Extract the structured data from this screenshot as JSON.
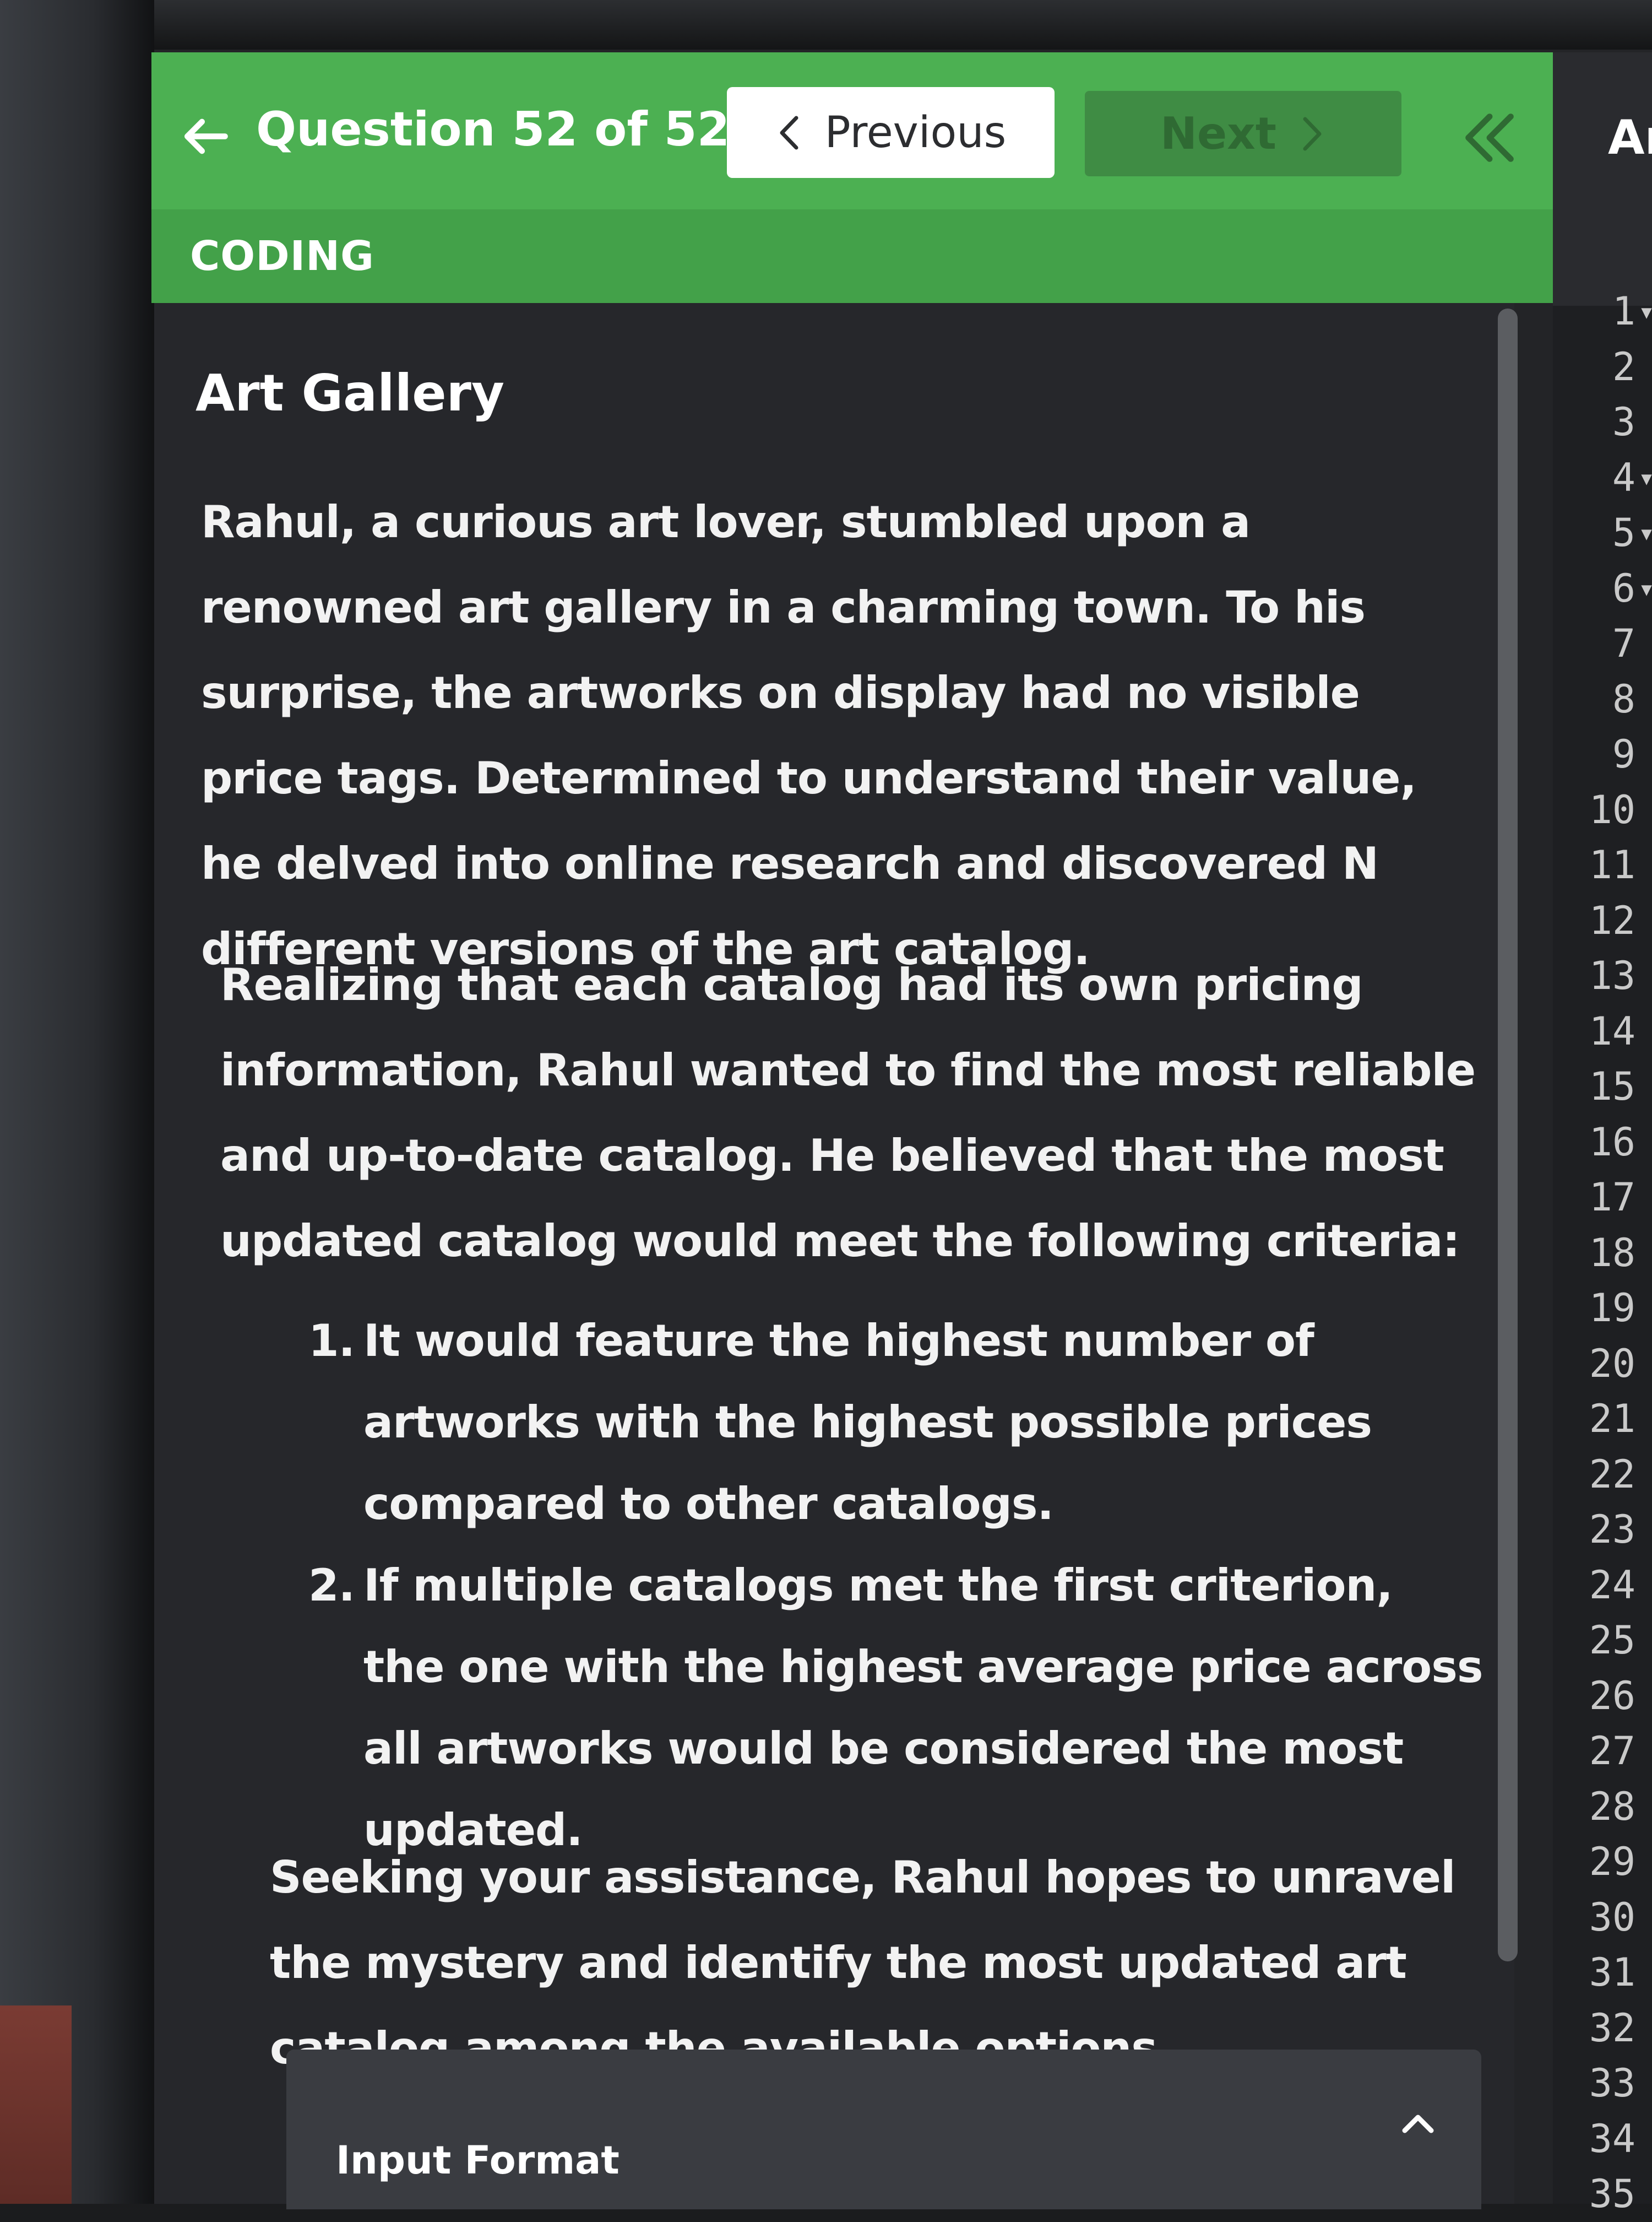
{
  "header": {
    "question_title": "Question 52 of 52",
    "previous_label": "Previous",
    "next_label": "Next",
    "category": "CODING",
    "accent_color": "#4cb052"
  },
  "problem": {
    "title": "Art Gallery",
    "paragraph1": "Rahul, a curious art lover, stumbled upon a renowned art gallery in a charming town. To his surprise, the artworks on display had no visible price tags. Determined to understand their value, he delved into online research and discovered ",
    "paragraph1_bold": "N",
    "paragraph1_end": " different versions of the art catalog.",
    "paragraph2": "Realizing that each catalog had its own pricing information, Rahul wanted to find the most reliable and up-to-date catalog. He believed that the most updated catalog would meet the following criteria:",
    "criteria": [
      {
        "num": "1.",
        "text": "It would feature the highest number of artworks with the highest possible prices compared to other catalogs."
      },
      {
        "num": "2.",
        "text": "If multiple catalogs met the first criterion, the one with the highest average price across all artworks would be considered the most updated."
      }
    ],
    "paragraph3": "Seeking your assistance, Rahul hopes to unravel the mystery and identify the most updated art catalog among the available options.",
    "section_input_format": "Input Format"
  },
  "editor": {
    "header_text": "Ar",
    "line_numbers": [
      "1",
      "2",
      "3",
      "4",
      "5",
      "6",
      "7",
      "8",
      "9",
      "10",
      "11",
      "12",
      "13",
      "14",
      "15",
      "16",
      "17",
      "18",
      "19",
      "20",
      "21",
      "22",
      "23",
      "24",
      "25",
      "26",
      "27",
      "28",
      "29",
      "30",
      "31",
      "32",
      "33",
      "34",
      "35"
    ],
    "fold_markers": [
      "▾",
      "",
      "",
      "▾",
      "▾",
      "▾",
      "",
      "",
      "",
      "",
      "",
      "",
      "",
      "",
      "",
      "",
      "",
      "",
      "",
      "",
      "",
      "",
      "",
      "",
      "",
      "",
      "",
      "",
      "",
      "",
      "",
      "",
      "",
      "",
      ""
    ]
  },
  "icons": {
    "back": "arrow-left-icon",
    "previous": "chevron-left-icon",
    "next": "chevron-right-icon",
    "collapse": "double-chevron-left-icon",
    "expand": "chevron-up-icon"
  }
}
